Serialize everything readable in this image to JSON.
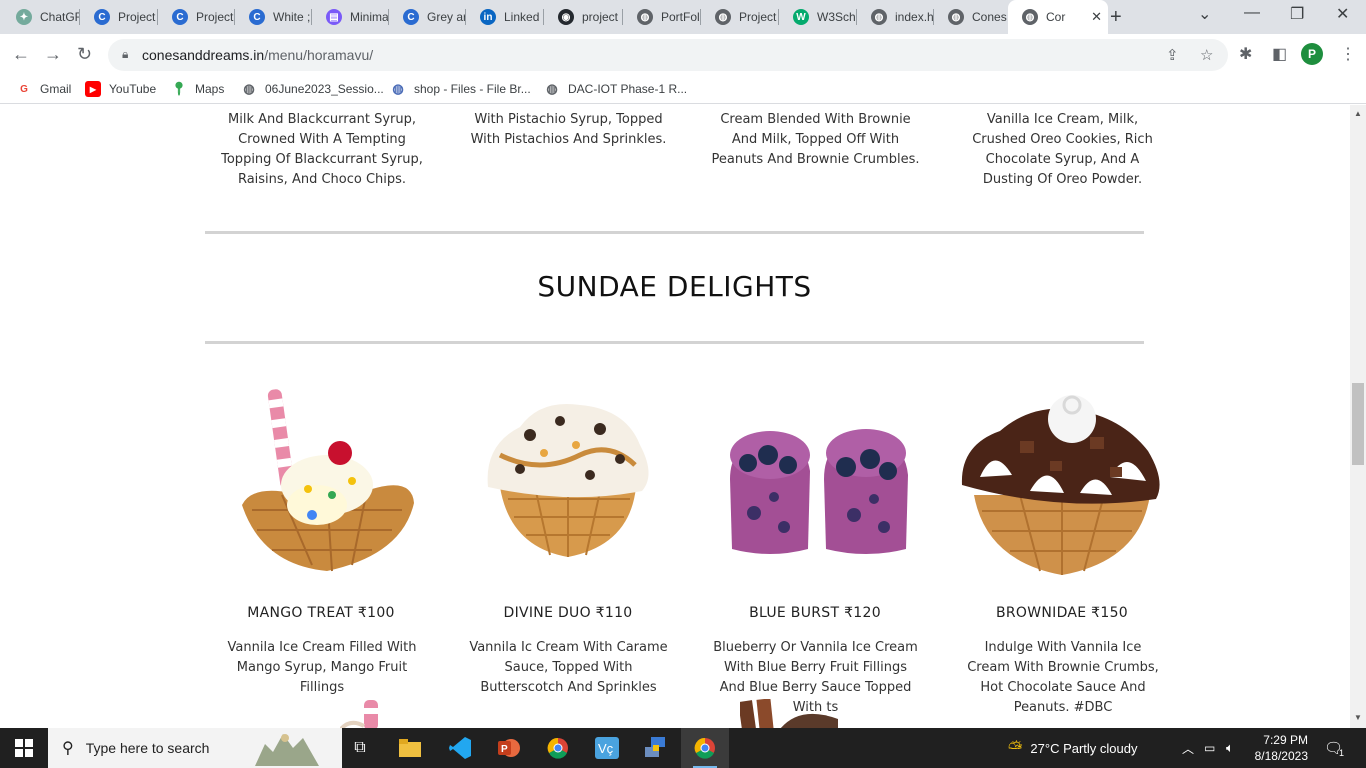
{
  "browser": {
    "tabs": [
      {
        "label": "ChatGF",
        "color": "#74aa9c",
        "glyph": "✦"
      },
      {
        "label": "Project",
        "color": "#2a6bd1",
        "glyph": "C"
      },
      {
        "label": "Project",
        "color": "#2a6bd1",
        "glyph": "C"
      },
      {
        "label": "White ;",
        "color": "#2a6bd1",
        "glyph": "C"
      },
      {
        "label": "Minima",
        "color": "#7a5af8",
        "glyph": "▤"
      },
      {
        "label": "Grey ar",
        "color": "#2a6bd1",
        "glyph": "C"
      },
      {
        "label": "Linked",
        "color": "#0a66c2",
        "glyph": "in"
      },
      {
        "label": "project",
        "color": "#24292f",
        "glyph": "◉"
      },
      {
        "label": "PortFol",
        "color": "#5f6368",
        "glyph": "◍"
      },
      {
        "label": "Project",
        "color": "#5f6368",
        "glyph": "◍"
      },
      {
        "label": "W3Sch",
        "color": "#04aa6d",
        "glyph": "W"
      },
      {
        "label": "index.h",
        "color": "#5f6368",
        "glyph": "◍"
      },
      {
        "label": "Cones",
        "color": "#5f6368",
        "glyph": "◍"
      },
      {
        "label": "Cor",
        "color": "#5f6368",
        "glyph": "◍"
      }
    ],
    "new_tab_label": "+",
    "url_host": "conesanddreams.in",
    "url_path": "/menu/horamavu/",
    "profile_initial": "P",
    "bookmarks": [
      {
        "label": "Gmail",
        "icon": "gmail-icon"
      },
      {
        "label": "YouTube",
        "icon": "youtube-icon"
      },
      {
        "label": "Maps",
        "icon": "maps-icon"
      },
      {
        "label": "06June2023_Sessio...",
        "icon": "globe-icon"
      },
      {
        "label": "shop - Files - File Br...",
        "icon": "globe-icon"
      },
      {
        "label": "DAC-IOT Phase-1 R...",
        "icon": "globe-icon"
      }
    ]
  },
  "page": {
    "top_descriptions": [
      "Milk And Blackcurrant Syrup, Crowned With A Tempting Topping Of Blackcurrant Syrup, Raisins, And Choco Chips.",
      "With Pistachio Syrup, Topped With Pistachios And Sprinkles.",
      "Cream Blended With Brownie And Milk, Topped Off With Peanuts And Brownie Crumbles.",
      "Vanilla Ice Cream, Milk, Crushed Oreo Cookies, Rich Chocolate Syrup, And A Dusting Of Oreo Powder."
    ],
    "section_title": "SUNDAE DELIGHTS",
    "products": [
      {
        "name": "MANGO TREAT ₹100",
        "description": "Vannila Ice Cream Filled With Mango Syrup, Mango Fruit Fillings"
      },
      {
        "name": "DIVINE DUO ₹110",
        "description": "Vannila Ic Cream With Carame Sauce, Topped With Butterscotch And Sprinkles"
      },
      {
        "name": "BLUE BURST ₹120",
        "description": "Blueberry Or Vannila Ice Cream With Blue Berry Fruit Fillings And Blue Berry Sauce Topped With ts"
      },
      {
        "name": "BROWNIDAE ₹150",
        "description": "Indulge With Vannila Ice Cream With Brownie Crumbs, Hot Chocolate Sauce And Peanuts. #DBC"
      }
    ]
  },
  "taskbar": {
    "search_placeholder": "Type here to search",
    "weather": "27°C  Partly cloudy",
    "time": "7:29 PM",
    "date": "8/18/2023",
    "notification_count": "1"
  }
}
